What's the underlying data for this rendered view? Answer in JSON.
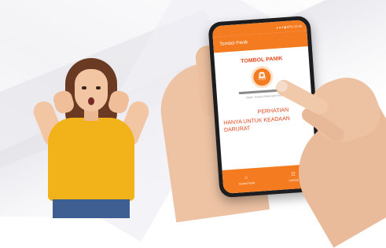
{
  "statusbar": {
    "text": "● ● ▾ ▮ 97% 12:16"
  },
  "app": {
    "title": "Tombol Panik"
  },
  "panic": {
    "title": "TOMBOL PANIK",
    "button_icon": "alarm-icon",
    "progress": 0.82,
    "hint": "Tahan Tombol Beberapa Detik"
  },
  "warning": {
    "title": "PERHATIAN",
    "body": "HANYA UNTUK KEADAAN DARURAT"
  },
  "bottom_nav": [
    {
      "label": "Tombol Panik",
      "icon": "home-icon"
    },
    {
      "label": "Lainnya",
      "icon": "grid-icon"
    }
  ],
  "colors": {
    "accent": "#f47b20",
    "warning": "#e2471c"
  }
}
